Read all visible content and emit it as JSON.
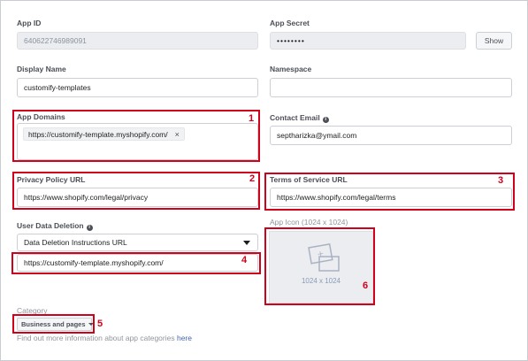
{
  "app_id": {
    "label": "App ID",
    "value": "640622746989091"
  },
  "app_secret": {
    "label": "App Secret",
    "value": "••••••••",
    "show_label": "Show"
  },
  "display_name": {
    "label": "Display Name",
    "value": "customify-templates"
  },
  "namespace": {
    "label": "Namespace",
    "value": ""
  },
  "app_domains": {
    "label": "App Domains",
    "tokens": [
      "https://customify-template.myshopify.com/"
    ],
    "remove_glyph": "×"
  },
  "contact_email": {
    "label": "Contact Email",
    "value": "septharizka@ymail.com"
  },
  "privacy_policy": {
    "label": "Privacy Policy URL",
    "value": "https://www.shopify.com/legal/privacy"
  },
  "terms_of_service": {
    "label": "Terms of Service URL",
    "value": "https://www.shopify.com/legal/terms"
  },
  "user_data_deletion": {
    "label": "User Data Deletion",
    "selected": "Data Deletion Instructions URL",
    "url": "https://customify-template.myshopify.com/"
  },
  "app_icon": {
    "label": "App Icon (1024 x 1024)",
    "size_text": "1024 x 1024"
  },
  "category": {
    "label": "Category",
    "selected": "Business and pages",
    "help_text": "Find out more information about app categories ",
    "help_link": "here"
  },
  "annotations": [
    "1",
    "2",
    "3",
    "4",
    "5",
    "6"
  ],
  "colors": {
    "highlight": "#d0021b",
    "link": "#4267b2"
  }
}
